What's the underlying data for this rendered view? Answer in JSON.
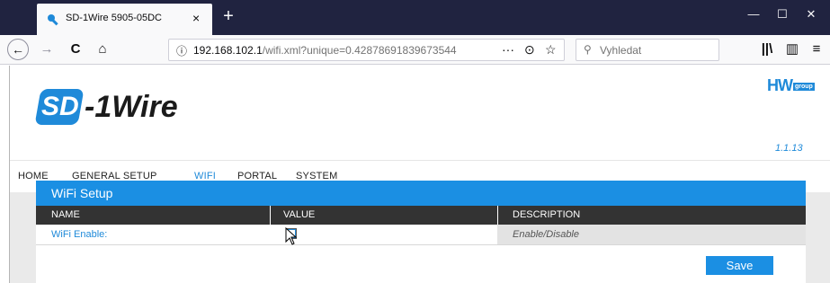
{
  "browser": {
    "tab_title": "SD-1Wire 5905-05DC",
    "tab_close": "×",
    "new_tab": "+",
    "window_buttons": {
      "minimize": "—",
      "maximize": "☐",
      "close": "✕"
    },
    "nav": {
      "back": "←",
      "forward": "→",
      "reload": "C",
      "home": "⌂"
    },
    "url_info": "ⓘ",
    "url_host": "192.168.102.1",
    "url_path": "/wifi.xml?unique=0.42878691839673544",
    "url_actions": {
      "more": "···",
      "pocket": "⊙",
      "bookmark": "☆"
    },
    "search_placeholder": "Vyhledat",
    "toolbar": {
      "library": "\\",
      "sidebar": "▥",
      "menu": "≡"
    }
  },
  "header": {
    "logo_sd": "SD",
    "logo_rest": "-1Wire",
    "hw_logo": "HW",
    "hw_group": "group",
    "version": "1.1.13"
  },
  "menu": {
    "items": [
      "HOME",
      "GENERAL SETUP",
      "WIFI",
      "PORTAL",
      "SYSTEM"
    ],
    "active": "WIFI"
  },
  "panel": {
    "title": "WiFi Setup",
    "columns": [
      "NAME",
      "VALUE",
      "DESCRIPTION"
    ],
    "rows": [
      {
        "name": "WiFi Enable:",
        "value_checked": false,
        "description": "Enable/Disable"
      }
    ],
    "save_label": "Save"
  },
  "colors": {
    "accent": "#1b8fe3",
    "header_dark": "#333333",
    "titlebar": "#202340"
  }
}
